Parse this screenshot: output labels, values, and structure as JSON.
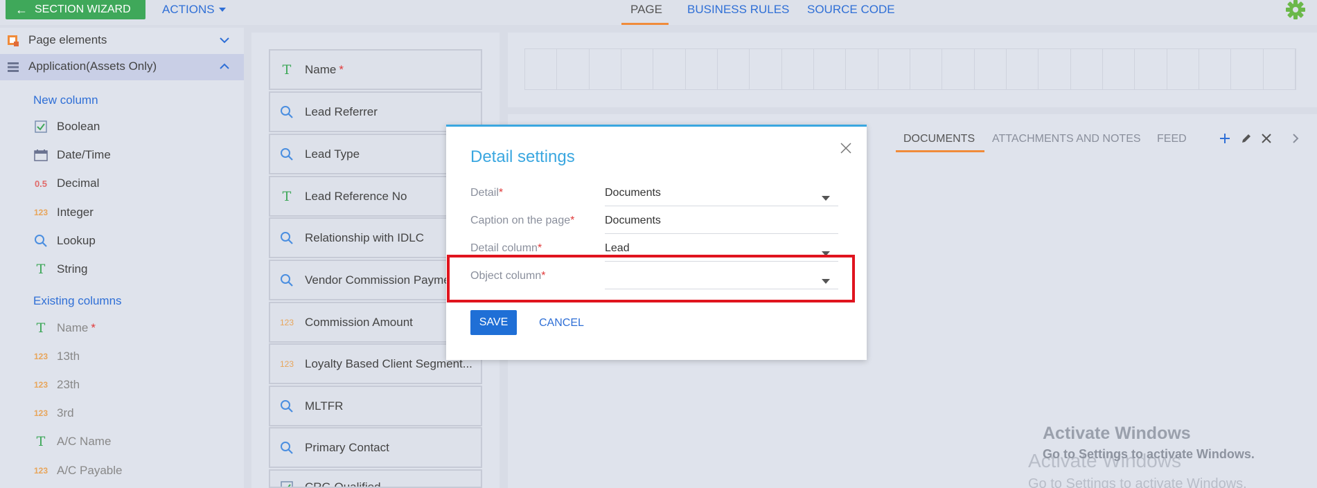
{
  "topbar": {
    "wizard_label": "SECTION WIZARD",
    "actions_label": "ACTIONS",
    "tabs": [
      {
        "label": "PAGE"
      },
      {
        "label": "BUSINESS RULES"
      },
      {
        "label": "SOURCE CODE"
      }
    ]
  },
  "sidebar": {
    "groups": [
      {
        "label": "Page elements"
      },
      {
        "label": "Application(Assets Only)"
      }
    ],
    "new_column_title": "New column",
    "new_columns": [
      {
        "label": "Boolean",
        "icon": "checkbox-icon"
      },
      {
        "label": "Date/Time",
        "icon": "calendar-icon"
      },
      {
        "label": "Decimal",
        "icon": "decimal-icon",
        "glyph": "0.5"
      },
      {
        "label": "Integer",
        "icon": "integer-icon",
        "glyph": "123"
      },
      {
        "label": "Lookup",
        "icon": "search-icon"
      },
      {
        "label": "String",
        "icon": "text-icon",
        "glyph": "T"
      }
    ],
    "existing_columns_title": "Existing columns",
    "existing_columns": [
      {
        "label": "Name",
        "icon": "text-icon",
        "glyph": "T",
        "required_mark": "*"
      },
      {
        "label": "13th",
        "icon": "integer-icon",
        "glyph": "123"
      },
      {
        "label": "23th",
        "icon": "integer-icon",
        "glyph": "123"
      },
      {
        "label": "3rd",
        "icon": "integer-icon",
        "glyph": "123"
      },
      {
        "label": "A/C Name",
        "icon": "text-icon",
        "glyph": "T"
      },
      {
        "label": "A/C Payable",
        "icon": "integer-icon",
        "glyph": "123"
      }
    ]
  },
  "fields": [
    {
      "label": "Name",
      "icon": "text-icon",
      "glyph": "T",
      "required_mark": "*"
    },
    {
      "label": "Lead Referrer",
      "icon": "search-icon"
    },
    {
      "label": "Lead Type",
      "icon": "search-icon"
    },
    {
      "label": "Lead Reference No",
      "icon": "text-icon",
      "glyph": "T"
    },
    {
      "label": "Relationship with IDLC",
      "icon": "search-icon"
    },
    {
      "label": "Vendor Commission Payment",
      "icon": "search-icon"
    },
    {
      "label": "Commission Amount",
      "icon": "integer-icon",
      "glyph": "123"
    },
    {
      "label": "Loyalty Based Client Segment...",
      "icon": "integer-icon",
      "glyph": "123"
    },
    {
      "label": "MLTFR",
      "icon": "search-icon"
    },
    {
      "label": "Primary Contact",
      "icon": "search-icon"
    },
    {
      "label": "CRG Qualified",
      "icon": "checkbox-icon"
    }
  ],
  "detail_tabs": [
    {
      "label": "DOCUMENTS"
    },
    {
      "label": "ATTACHMENTS AND NOTES"
    },
    {
      "label": "FEED"
    }
  ],
  "modal": {
    "title": "Detail settings",
    "required_mark": "*",
    "rows": [
      {
        "label": "Detail",
        "value": "Documents",
        "dropdown": true
      },
      {
        "label": "Caption on the page",
        "value": "Documents",
        "dropdown": false
      },
      {
        "label": "Detail column",
        "value": "Lead",
        "dropdown": true
      },
      {
        "label": "Object column",
        "value": "",
        "dropdown": true
      }
    ],
    "save_label": "SAVE",
    "cancel_label": "CANCEL"
  },
  "watermark": {
    "title": "Activate Windows",
    "subtitle": "Go to Settings to activate Windows."
  },
  "colors": {
    "accent_blue": "#2f6fd6",
    "wizard_green": "#3fa85a",
    "modal_title_blue": "#3aa7e0",
    "tab_orange": "#f08b3a",
    "highlight_red": "#e0141e"
  }
}
